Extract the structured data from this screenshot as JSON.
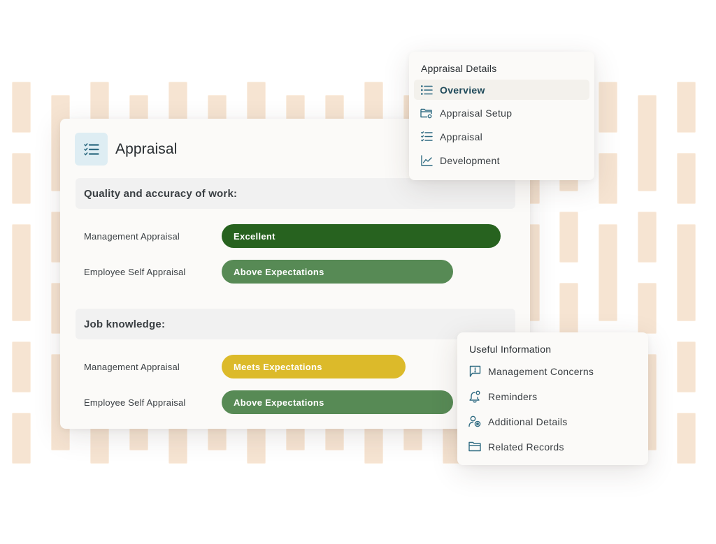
{
  "colors": {
    "excellent": "#27621f",
    "above_expectations": "#578a55",
    "meets_expectations": "#dcba2a",
    "icon_teal": "#2f6b82",
    "background_bar": "#f6e4d2"
  },
  "main_card": {
    "icon": "checklist-icon",
    "title": "Appraisal",
    "sections": [
      {
        "heading": "Quality and accuracy of work:",
        "ratings": [
          {
            "label": "Management Appraisal",
            "value": "Excellent",
            "level": "excellent",
            "fill_fraction": 1.0
          },
          {
            "label": "Employee Self Appraisal",
            "value": "Above Expectations",
            "level": "above_expectations",
            "fill_fraction": 0.83
          }
        ]
      },
      {
        "heading": "Job knowledge:",
        "ratings": [
          {
            "label": "Management Appraisal",
            "value": "Meets Expectations",
            "level": "meets_expectations",
            "fill_fraction": 0.66
          },
          {
            "label": "Employee Self Appraisal",
            "value": "Above Expectations",
            "level": "above_expectations",
            "fill_fraction": 0.83
          }
        ]
      }
    ]
  },
  "details_menu": {
    "title": "Appraisal Details",
    "items": [
      {
        "label": "Overview",
        "icon": "list-icon",
        "active": true
      },
      {
        "label": "Appraisal Setup",
        "icon": "folder-settings-icon",
        "active": false
      },
      {
        "label": "Appraisal",
        "icon": "checklist-icon",
        "active": false
      },
      {
        "label": "Development",
        "icon": "line-chart-icon",
        "active": false
      }
    ]
  },
  "info_menu": {
    "title": "Useful Information",
    "items": [
      {
        "label": "Management Concerns",
        "icon": "message-alert-icon"
      },
      {
        "label": "Reminders",
        "icon": "bell-icon"
      },
      {
        "label": "Additional Details",
        "icon": "user-settings-icon"
      },
      {
        "label": "Related Records",
        "icon": "folder-icon"
      }
    ]
  }
}
